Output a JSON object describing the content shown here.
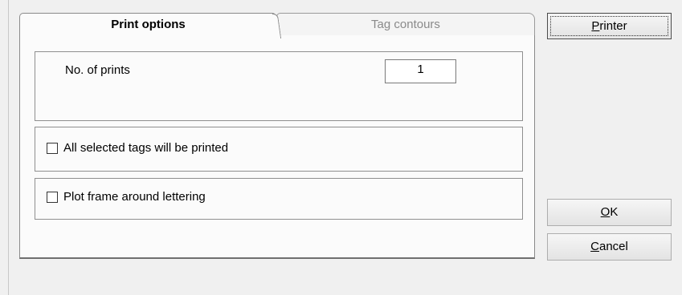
{
  "tabs": [
    {
      "label": "Print options",
      "active": true
    },
    {
      "label": "Tag contours",
      "active": false
    }
  ],
  "print_options": {
    "no_of_prints_label": "No. of prints",
    "no_of_prints_value": "1",
    "all_selected_label": "All selected tags will be printed",
    "all_selected_checked": false,
    "plot_frame_label": "Plot frame around lettering",
    "plot_frame_checked": false
  },
  "buttons": {
    "printer": {
      "mnemonic": "P",
      "rest": "rinter"
    },
    "ok": {
      "mnemonic": "O",
      "rest": "K"
    },
    "cancel": {
      "mnemonic": "C",
      "rest": "ancel"
    }
  }
}
